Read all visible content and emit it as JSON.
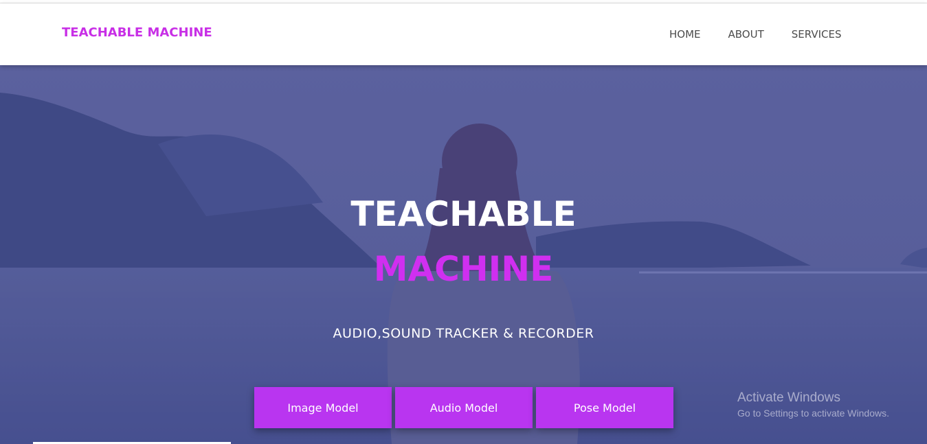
{
  "brand": "TEACHABLE MACHINE",
  "nav": {
    "items": [
      {
        "label": "HOME"
      },
      {
        "label": "ABOUT"
      },
      {
        "label": "SERVICES"
      }
    ]
  },
  "hero": {
    "title_line1": "TEACHABLE",
    "title_line2": "MACHINE",
    "subtitle": "AUDIO,SOUND TRACKER & RECORDER",
    "buttons": [
      {
        "label": "Image Model"
      },
      {
        "label": "Audio Model"
      },
      {
        "label": "Pose Model"
      }
    ]
  },
  "watermark": {
    "title": "Activate Windows",
    "subtitle": "Go to Settings to activate Windows."
  },
  "colors": {
    "accent": "#c82fe6",
    "button": "#b935f0",
    "hero_overlay": "#5a6298"
  }
}
